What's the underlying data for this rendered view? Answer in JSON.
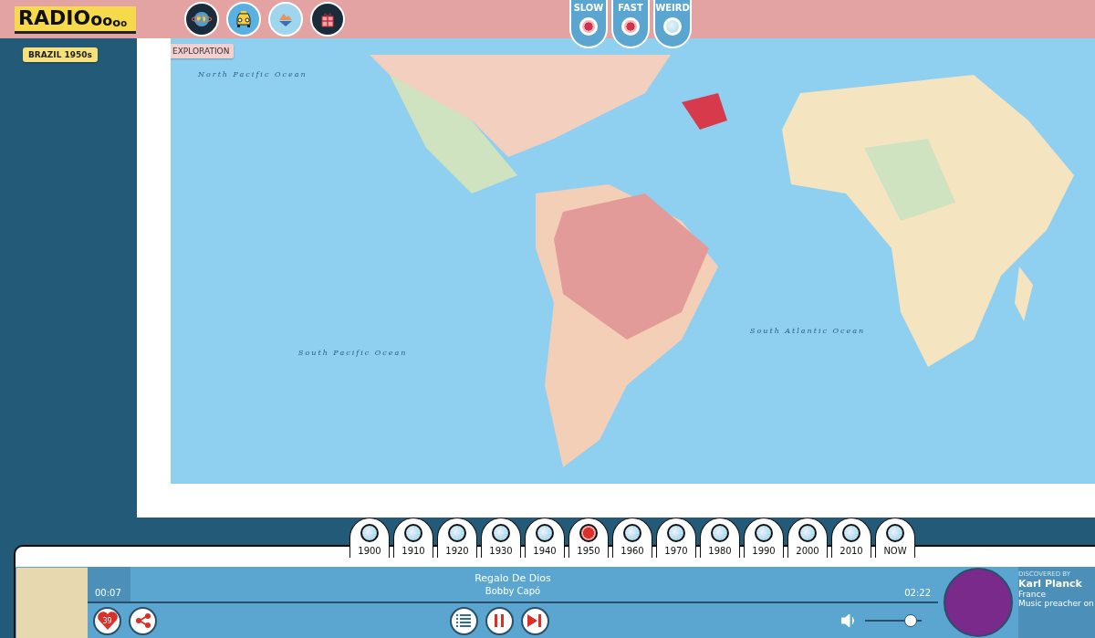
{
  "logo": {
    "text": "RADI",
    "tail": "Ooooo"
  },
  "moods": [
    {
      "label": "SLOW",
      "selected": true
    },
    {
      "label": "FAST",
      "selected": true
    },
    {
      "label": "WEIRD",
      "selected": false
    }
  ],
  "sidebar": {
    "badge": "BRAZIL 1950s"
  },
  "map": {
    "tag": "EXPLORATION",
    "labels": [
      {
        "text": "North Pacific Ocean",
        "kind": "ocean"
      },
      {
        "text": "South Pacific Ocean",
        "kind": "ocean"
      },
      {
        "text": "South Atlantic Ocean",
        "kind": "ocean"
      }
    ]
  },
  "years": [
    {
      "label": "1900",
      "selected": false
    },
    {
      "label": "1910",
      "selected": false
    },
    {
      "label": "1920",
      "selected": false
    },
    {
      "label": "1930",
      "selected": false
    },
    {
      "label": "1940",
      "selected": false
    },
    {
      "label": "1950",
      "selected": true
    },
    {
      "label": "1960",
      "selected": false
    },
    {
      "label": "1970",
      "selected": false
    },
    {
      "label": "1980",
      "selected": false
    },
    {
      "label": "1990",
      "selected": false
    },
    {
      "label": "2000",
      "selected": false
    },
    {
      "label": "2010",
      "selected": false
    },
    {
      "label": "NOW",
      "selected": false
    }
  ],
  "player": {
    "title": "Regalo De Dios",
    "artist": "Bobby Capó",
    "elapsed": "00:07",
    "duration": "02:22",
    "level": 0.05,
    "likes": "39",
    "volume": {
      "level": 0.9
    },
    "playing": true
  },
  "discovered": {
    "label": "DISCOVERED BY",
    "name": "Karl Planck",
    "country": "France",
    "bio": "Music preacher on"
  }
}
